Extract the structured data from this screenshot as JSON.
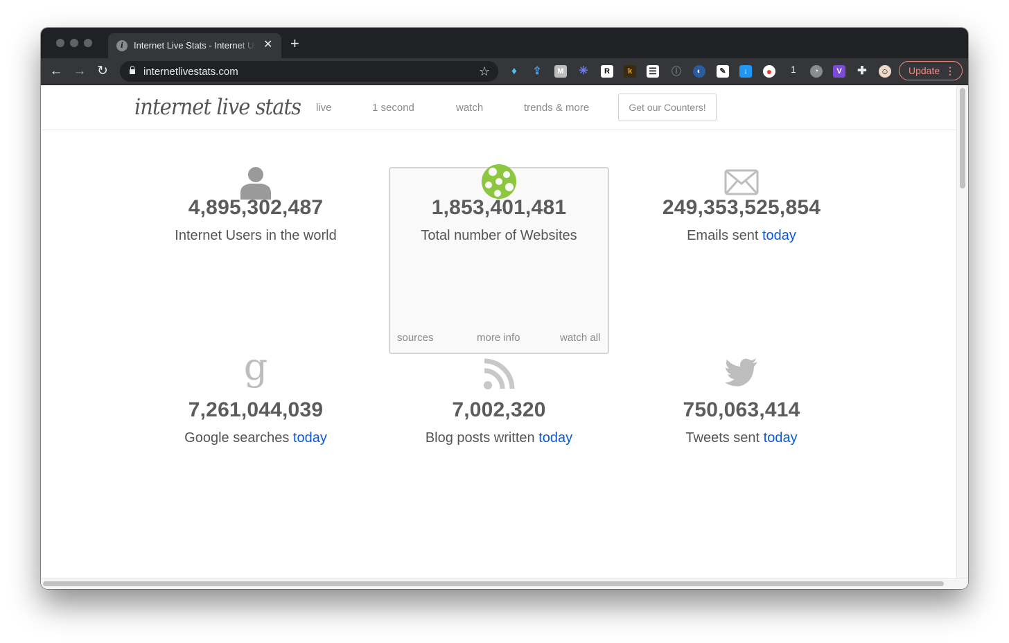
{
  "browser": {
    "tab_title": "Internet Live Stats - Internet Usage & Social Media Statistics",
    "url": "internetlivestats.com",
    "extension_badge_count": "1",
    "update_label": "Update"
  },
  "site": {
    "logo_text": "internet live stats",
    "nav": [
      "live",
      "1 second",
      "watch",
      "trends & more"
    ],
    "counters_button": "Get our Counters!"
  },
  "stats": [
    {
      "value": "4,895,302,487",
      "label": "Internet Users in the world",
      "today": ""
    },
    {
      "value": "1,853,401,481",
      "label": "Total number of Websites",
      "today": ""
    },
    {
      "value": "249,353,525,854",
      "label": "Emails sent ",
      "today": "today"
    },
    {
      "value": "7,261,044,039",
      "label": "Google searches ",
      "today": "today"
    },
    {
      "value": "7,002,320",
      "label": "Blog posts written ",
      "today": "today"
    },
    {
      "value": "750,063,414",
      "label": "Tweets sent ",
      "today": "today"
    }
  ],
  "feature_box_links": [
    "sources",
    "more info",
    "watch all"
  ],
  "icons": [
    "user-icon",
    "globe-icon",
    "envelope-icon",
    "google-icon",
    "rss-icon",
    "twitter-icon"
  ],
  "colors": {
    "link": "#0a59d6",
    "number": "#5c5c5c",
    "globe": "#8dc63f"
  }
}
